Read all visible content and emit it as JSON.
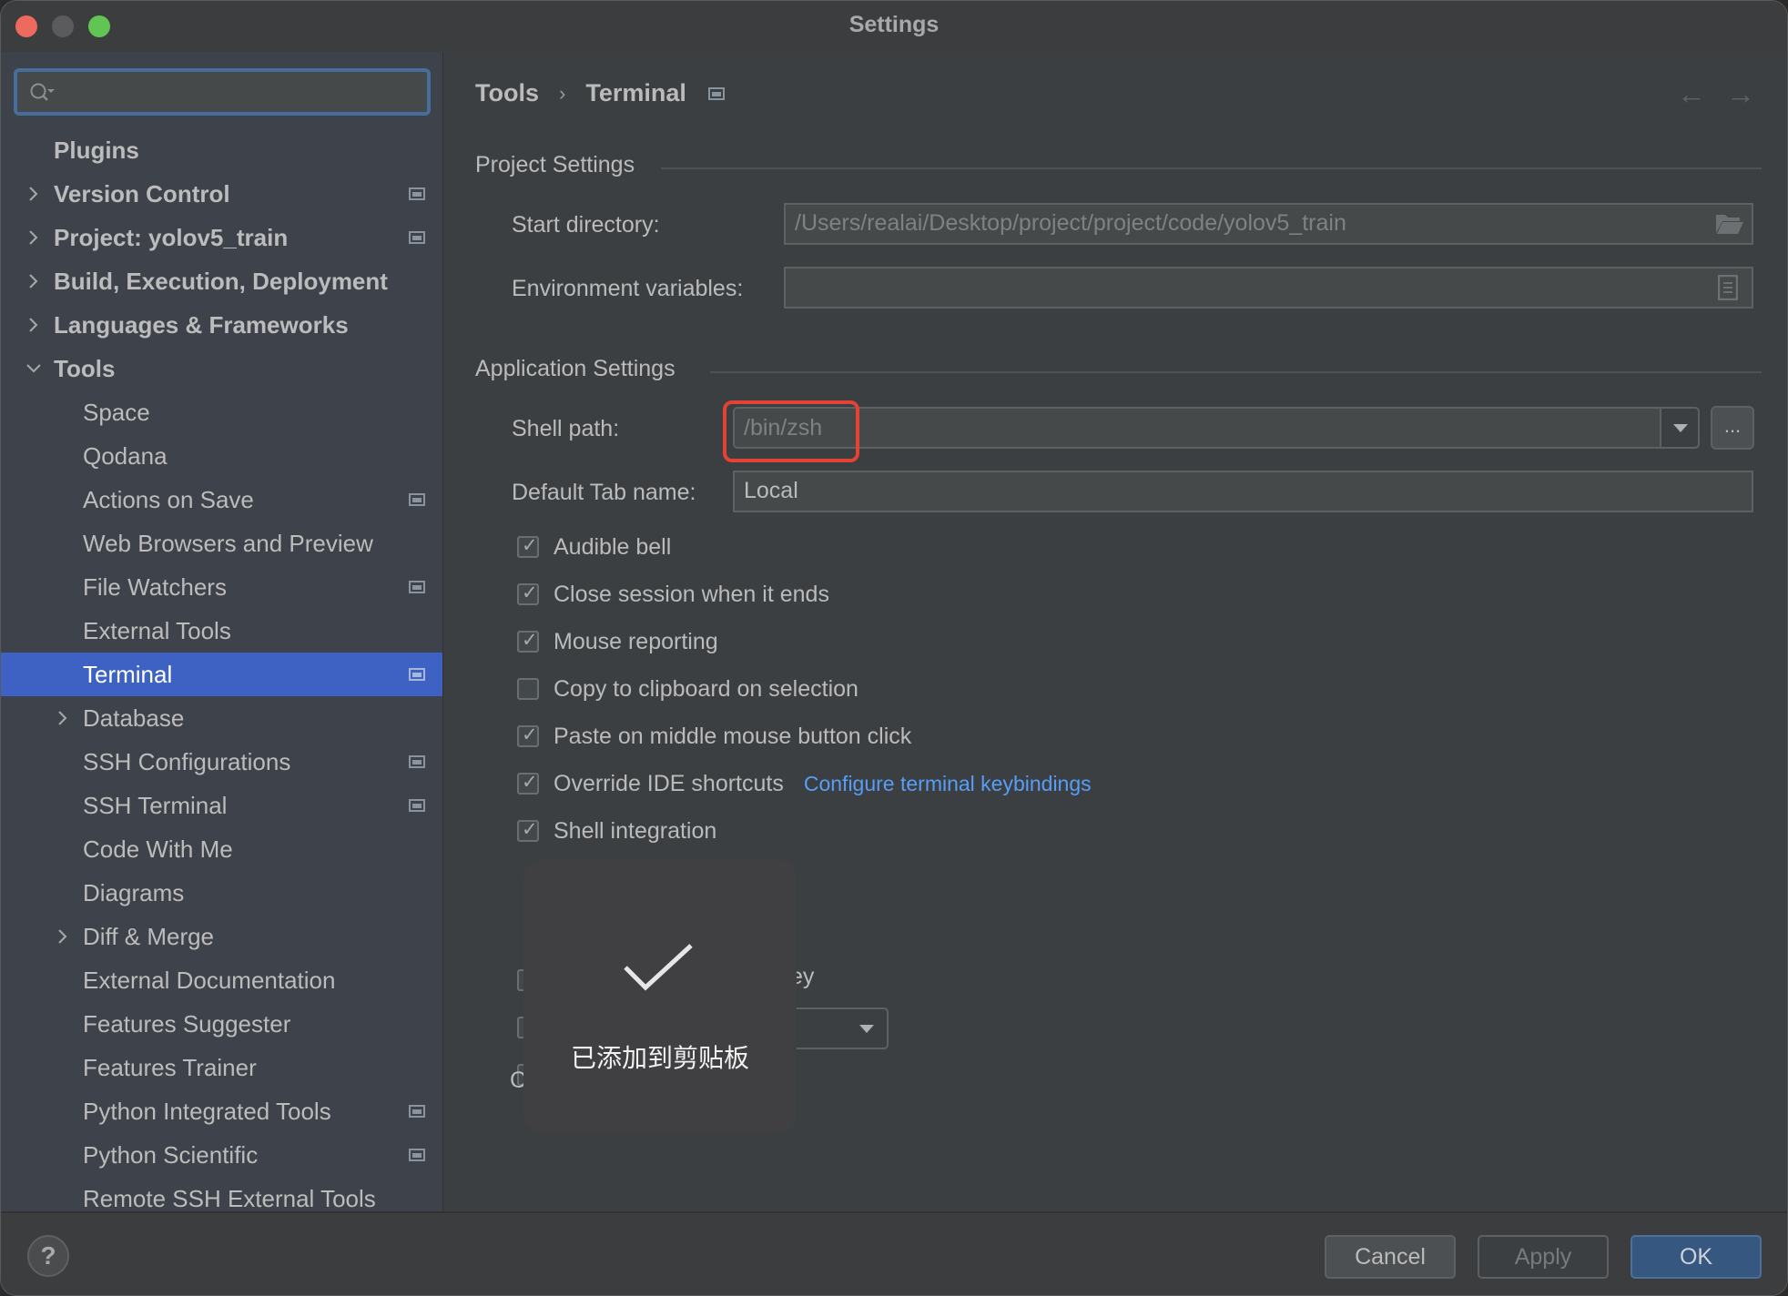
{
  "window": {
    "title": "Settings"
  },
  "sidebar": {
    "search": {
      "value": "",
      "placeholder": ""
    },
    "items": [
      {
        "label": "Plugins",
        "level": 0,
        "bold": true,
        "expandable": false,
        "expanded": false,
        "project_icon": false,
        "selected": false
      },
      {
        "label": "Version Control",
        "level": 0,
        "bold": true,
        "expandable": true,
        "expanded": false,
        "project_icon": true,
        "selected": false
      },
      {
        "label": "Project: yolov5_train",
        "level": 0,
        "bold": true,
        "expandable": true,
        "expanded": false,
        "project_icon": true,
        "selected": false
      },
      {
        "label": "Build, Execution, Deployment",
        "level": 0,
        "bold": true,
        "expandable": true,
        "expanded": false,
        "project_icon": false,
        "selected": false
      },
      {
        "label": "Languages & Frameworks",
        "level": 0,
        "bold": true,
        "expandable": true,
        "expanded": false,
        "project_icon": false,
        "selected": false
      },
      {
        "label": "Tools",
        "level": 0,
        "bold": true,
        "expandable": true,
        "expanded": true,
        "project_icon": false,
        "selected": false
      },
      {
        "label": "Space",
        "level": 1,
        "bold": false,
        "expandable": false,
        "expanded": false,
        "project_icon": false,
        "selected": false
      },
      {
        "label": "Qodana",
        "level": 1,
        "bold": false,
        "expandable": false,
        "expanded": false,
        "project_icon": false,
        "selected": false
      },
      {
        "label": "Actions on Save",
        "level": 1,
        "bold": false,
        "expandable": false,
        "expanded": false,
        "project_icon": true,
        "selected": false
      },
      {
        "label": "Web Browsers and Preview",
        "level": 1,
        "bold": false,
        "expandable": false,
        "expanded": false,
        "project_icon": false,
        "selected": false
      },
      {
        "label": "File Watchers",
        "level": 1,
        "bold": false,
        "expandable": false,
        "expanded": false,
        "project_icon": true,
        "selected": false
      },
      {
        "label": "External Tools",
        "level": 1,
        "bold": false,
        "expandable": false,
        "expanded": false,
        "project_icon": false,
        "selected": false
      },
      {
        "label": "Terminal",
        "level": 1,
        "bold": false,
        "expandable": false,
        "expanded": false,
        "project_icon": true,
        "selected": true
      },
      {
        "label": "Database",
        "level": 1,
        "bold": false,
        "expandable": true,
        "expanded": false,
        "project_icon": false,
        "selected": false
      },
      {
        "label": "SSH Configurations",
        "level": 1,
        "bold": false,
        "expandable": false,
        "expanded": false,
        "project_icon": true,
        "selected": false
      },
      {
        "label": "SSH Terminal",
        "level": 1,
        "bold": false,
        "expandable": false,
        "expanded": false,
        "project_icon": true,
        "selected": false
      },
      {
        "label": "Code With Me",
        "level": 1,
        "bold": false,
        "expandable": false,
        "expanded": false,
        "project_icon": false,
        "selected": false
      },
      {
        "label": "Diagrams",
        "level": 1,
        "bold": false,
        "expandable": false,
        "expanded": false,
        "project_icon": false,
        "selected": false
      },
      {
        "label": "Diff & Merge",
        "level": 1,
        "bold": false,
        "expandable": true,
        "expanded": false,
        "project_icon": false,
        "selected": false
      },
      {
        "label": "External Documentation",
        "level": 1,
        "bold": false,
        "expandable": false,
        "expanded": false,
        "project_icon": false,
        "selected": false
      },
      {
        "label": "Features Suggester",
        "level": 1,
        "bold": false,
        "expandable": false,
        "expanded": false,
        "project_icon": false,
        "selected": false
      },
      {
        "label": "Features Trainer",
        "level": 1,
        "bold": false,
        "expandable": false,
        "expanded": false,
        "project_icon": false,
        "selected": false
      },
      {
        "label": "Python Integrated Tools",
        "level": 1,
        "bold": false,
        "expandable": false,
        "expanded": false,
        "project_icon": true,
        "selected": false
      },
      {
        "label": "Python Scientific",
        "level": 1,
        "bold": false,
        "expandable": false,
        "expanded": false,
        "project_icon": true,
        "selected": false
      },
      {
        "label": "Remote SSH External Tools",
        "level": 1,
        "bold": false,
        "expandable": false,
        "expanded": false,
        "project_icon": false,
        "selected": false
      }
    ]
  },
  "content": {
    "breadcrumb": {
      "parent": "Tools",
      "separator": "›",
      "current": "Terminal"
    },
    "nav": {
      "back": "←",
      "forward": "→"
    },
    "project_settings": {
      "title": "Project Settings",
      "start_directory": {
        "label": "Start directory:",
        "value": "/Users/realai/Desktop/project/project/code/yolov5_train"
      },
      "environment_variables": {
        "label": "Environment variables:",
        "value": ""
      }
    },
    "application_settings": {
      "title": "Application Settings",
      "shell_path": {
        "label": "Shell path:",
        "value": "/bin/zsh",
        "browse_label": "..."
      },
      "default_tab_name": {
        "label": "Default Tab name:",
        "value": "Local"
      },
      "checkboxes": [
        {
          "label": "Audible bell",
          "checked": true
        },
        {
          "label": "Close session when it ends",
          "checked": true
        },
        {
          "label": "Mouse reporting",
          "checked": true
        },
        {
          "label": "Copy to clipboard on selection",
          "checked": false
        },
        {
          "label": "Paste on middle mouse button click",
          "checked": true
        },
        {
          "label": "Override IDE shortcuts",
          "checked": true,
          "link": "Configure terminal keybindings"
        },
        {
          "label": "Shell integration",
          "checked": true
        }
      ],
      "obscured": {
        "partial_text_ey": "ey",
        "partial_label_c": "C"
      }
    }
  },
  "toast": {
    "icon": "checkmark-icon",
    "message": "已添加到剪贴板"
  },
  "footer": {
    "help_label": "?",
    "cancel_label": "Cancel",
    "apply_label": "Apply",
    "ok_label": "OK"
  },
  "colors": {
    "selection": "#3d62c3",
    "link": "#589df6",
    "highlight_box": "#e34234",
    "ok_button": "#365880"
  }
}
